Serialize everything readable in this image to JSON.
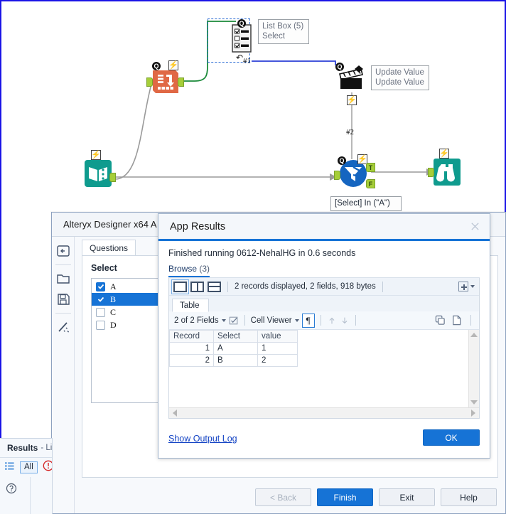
{
  "canvas": {
    "nodes": [
      {
        "id": "list-box",
        "tool_name": "List Box (5)",
        "tool_sub": "Select",
        "label": "#1",
        "icon": "list-box-icon"
      },
      {
        "id": "dynamic-rename",
        "tool_name": "",
        "tool_sub": "",
        "label": "",
        "icon": "dynamic-rename-icon"
      },
      {
        "id": "action",
        "tool_name": "Update Value",
        "tool_sub": "Update Value",
        "label": "#2",
        "icon": "action-clapper-icon"
      },
      {
        "id": "text-input",
        "tool_name": "",
        "tool_sub": "",
        "label": "",
        "icon": "book-icon"
      },
      {
        "id": "filter",
        "tool_name": "[Select] In (\"A\")",
        "tool_sub": "",
        "label": "",
        "icon": "filter-funnel-icon"
      },
      {
        "id": "browse",
        "tool_name": "",
        "tool_sub": "",
        "label": "",
        "icon": "binoculars-icon"
      }
    ],
    "port_labels": {
      "true": "T",
      "false": "F"
    }
  },
  "designer": {
    "title": "Alteryx Designer x64 A",
    "rail_icons": [
      "back-panel-icon",
      "open-folder-icon",
      "save-icon",
      "magic-wand-icon"
    ],
    "tabs": [
      {
        "label": "Questions"
      }
    ],
    "question": {
      "label": "Select",
      "items": [
        {
          "text": "A",
          "checked": true,
          "selected": false
        },
        {
          "text": "B",
          "checked": true,
          "selected": true
        },
        {
          "text": "C",
          "checked": false,
          "selected": false
        },
        {
          "text": "D",
          "checked": false,
          "selected": false
        }
      ]
    },
    "buttons": [
      {
        "label": "< Back",
        "state": "disabled",
        "accel": "B"
      },
      {
        "label": "Finish",
        "state": "primary",
        "accel": "F"
      },
      {
        "label": "Exit",
        "state": "normal",
        "accel": "E"
      },
      {
        "label": "Help",
        "state": "normal",
        "accel": ""
      }
    ]
  },
  "app_results": {
    "title": "App Results",
    "close_icon": "close-icon",
    "status": "Finished running 0612-NehalHG in 0.6 seconds",
    "browse_tab": {
      "label": "Browse",
      "count": "(3)"
    },
    "browse_toolbar": {
      "view_icons": [
        "single-pane-icon",
        "split-vertical-icon",
        "split-horizontal-icon"
      ],
      "record_summary": "2 records displayed, 2 fields, 918 bytes",
      "add_icon": "add-box-icon",
      "caret_icon": "chevron-down-icon"
    },
    "table_tab": "Table",
    "grid_toolbar": {
      "fields_label": "2 of 2 Fields",
      "fields_caret": "chevron-down-icon",
      "checkbox_icon": "select-fields-icon",
      "viewer_label": "Cell Viewer",
      "viewer_caret": "chevron-down-icon",
      "pilcrow": "¶",
      "up_icon": "arrow-up-icon",
      "down_icon": "arrow-down-icon",
      "copy_icon": "copy-icon",
      "newdoc_icon": "new-document-icon"
    },
    "grid": {
      "columns": [
        "Record",
        "Select",
        "value"
      ],
      "rows": [
        {
          "Record": "1",
          "Select": "A",
          "value": "1"
        },
        {
          "Record": "2",
          "Select": "B",
          "value": "2"
        }
      ]
    },
    "footer": {
      "show_log": "Show Output Log",
      "ok": "OK"
    }
  },
  "results_panel": {
    "title": "Results",
    "subtitle": "- Lis",
    "list_icon": "list-view-icon",
    "all_label": "All",
    "error_icon": "error-icon",
    "help_icon": "help-icon"
  },
  "colors": {
    "accent_blue": "#1673d6",
    "canvas_border": "#1a14e6",
    "teal": "#0f9b8e",
    "orange": "#e06845",
    "link_blue": "#1343c4",
    "port_green": "#a6ce39"
  }
}
